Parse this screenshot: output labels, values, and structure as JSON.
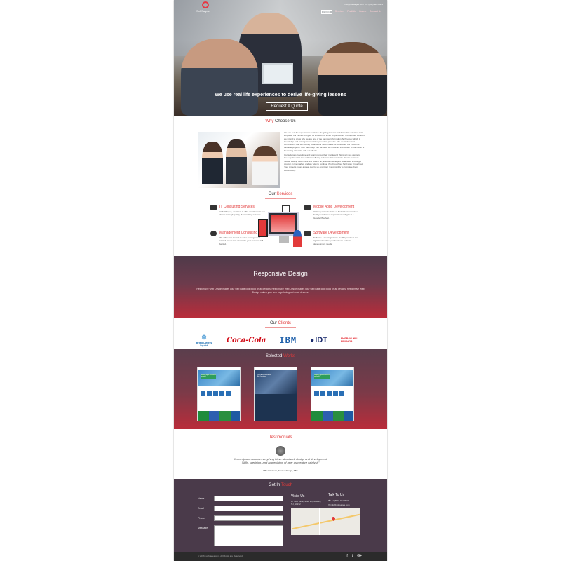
{
  "brand": {
    "name": "SoftSages",
    "accent": "#e23a3a"
  },
  "topbar": {
    "email": "info@softsages.com",
    "phone": "+1 (866)-924-0901"
  },
  "nav": {
    "items": [
      "Home",
      "Services",
      "Portfolio",
      "Career",
      "Contact Us"
    ]
  },
  "hero": {
    "tagline": "We use real life experiences to derive life-giving lessons",
    "cta": "Request A Quote"
  },
  "why": {
    "title_a": "Why ",
    "title_b": "Choose Us",
    "p1": "We use real life experiences to derive life-giving lessons and formulate solutions that empower our clients and give us a reason to strive for perfection. Through our solutions we intend to show why we are one of the topmost Information Technology which is knowledge and management-related providers provider. The dedication and commitment that we display towards our work makes us reliable for our customers' valuable projects. With each step that we take, we move an inch closer to our vision of becoming a favorite with our clients.",
    "p2": "Our solutions have time and again proved their mettle and this is why we aspire to keep up the spirit and embrace offering solutions that maximize clients' business needs. Having been there and done it all, attitude has helped us achieve a stronger position in the market, and we wish to continue this throughout hard work throughout. Your projects mean a great deal to us and it our responsibility to complete them successfully."
  },
  "services": {
    "title_a": "Our ",
    "title_b": "Services",
    "items": [
      {
        "name": "IT Consulting Services",
        "desc": "At SoftSages, we strive to offer excellence to our clients through quality IT consulting services."
      },
      {
        "name": "Mobile Apps Development",
        "desc": "Utilizing characteristics of Android framework to build your desired applications and give it a Google Play feel."
      },
      {
        "name": "Management Consulting",
        "desc": "We utilize our instinct to solve management-related issues that can make your business fall behind."
      },
      {
        "name": "Software Development",
        "desc": "Software - an integral part. SoftSages offers the right treatment to your business software development needs."
      }
    ]
  },
  "responsive": {
    "title": "Responsive Design",
    "text": "Responsive Web Design makes your web page look good on all devices. Responsive Web Design makes your web page look good on all devices. Responsive Web Design makes your web page look good on all devices."
  },
  "clients": {
    "title_a": "Our ",
    "title_b": "Clients",
    "logos": [
      "Bristol-Myers Squibb",
      "Coca-Cola",
      "IBM",
      "IDT",
      "McGRAW HILL FINANCIAL"
    ]
  },
  "works": {
    "title_a": "Selected ",
    "title_b": "Works",
    "items": [
      {
        "heading": "Helping digital marketers succeed"
      },
      {
        "heading": "Latin America and the Big Questions"
      },
      {
        "heading": "Helping digital marketers succeed"
      }
    ]
  },
  "testimonials": {
    "title": "Testimonials",
    "quote": "\"Lorem ipsum asserts everything I love about web design and development. Skills, precision, and appreciation of beer as creative catalyst.\"",
    "author": "Mike Davidson, head of Design, ABC"
  },
  "contact": {
    "title_a": "Get In ",
    "title_b": "Touch",
    "labels": {
      "name": "Name",
      "email": "Email",
      "phone": "Phone",
      "message": "Message"
    },
    "visit_title": "Visits Us",
    "address": "17 Mott Lane, Suite 2A, Newark, NJ, 10232",
    "talk_title": "Talk To Us",
    "phone": "+1 (866)-924-0901",
    "email": "info@softsages.com"
  },
  "footer": {
    "copyright": "© 2016, softsages.com. All Rights are Reserved.",
    "social": [
      "f",
      "t",
      "G+"
    ]
  }
}
